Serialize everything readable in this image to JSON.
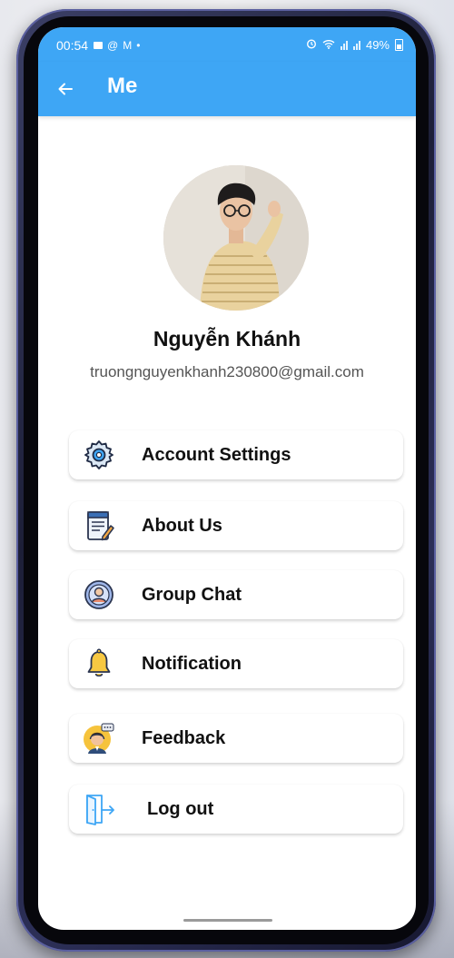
{
  "status_bar": {
    "time": "00:54",
    "battery": "49%"
  },
  "app_bar": {
    "title": "Me",
    "back_icon": "arrow-left-icon"
  },
  "profile": {
    "name": "Nguyễn Khánh",
    "email": "truongnguyenkhanh230800@gmail.com"
  },
  "menu": {
    "items": [
      {
        "label": "Account Settings",
        "icon": "gear-icon"
      },
      {
        "label": "About Us",
        "icon": "notepad-icon"
      },
      {
        "label": "Group Chat",
        "icon": "user-circle-icon"
      },
      {
        "label": "Notification",
        "icon": "bell-icon"
      },
      {
        "label": "Feedback",
        "icon": "support-agent-icon"
      },
      {
        "label": "Log out",
        "icon": "logout-door-icon"
      }
    ]
  },
  "colors": {
    "primary": "#3ea6f5",
    "text": "#111111",
    "secondary_text": "#555555"
  }
}
